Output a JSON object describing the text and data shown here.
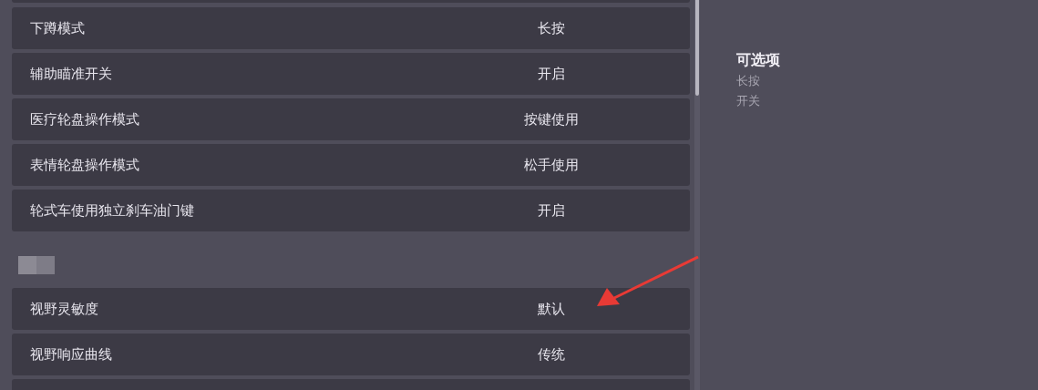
{
  "settings_group_1": [
    {
      "label": "下蹲模式",
      "value": "长按"
    },
    {
      "label": "辅助瞄准开关",
      "value": "开启"
    },
    {
      "label": "医疗轮盘操作模式",
      "value": "按键使用"
    },
    {
      "label": "表情轮盘操作模式",
      "value": "松手使用"
    },
    {
      "label": "轮式车使用独立刹车油门键",
      "value": "开启"
    }
  ],
  "settings_group_2": [
    {
      "label": "视野灵敏度",
      "value": "默认"
    },
    {
      "label": "视野响应曲线",
      "value": "传统"
    }
  ],
  "options_panel": {
    "title": "可选项",
    "options": [
      "长按",
      "开关"
    ]
  }
}
